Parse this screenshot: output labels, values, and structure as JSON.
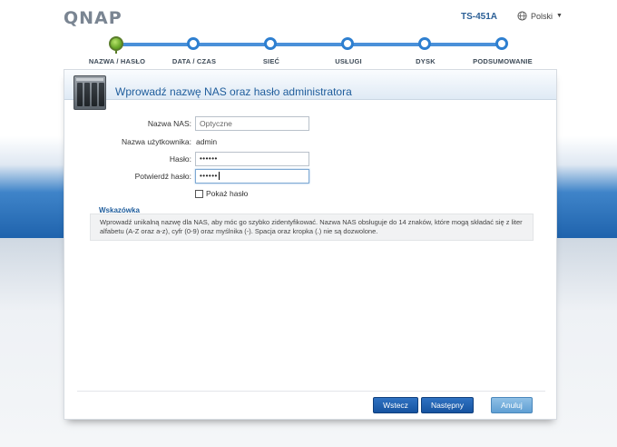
{
  "header": {
    "logo": "QNAP",
    "model": "TS-451A",
    "language": "Polski"
  },
  "steps": [
    {
      "label": "NAZWA / HASŁO",
      "active": true
    },
    {
      "label": "DATA / CZAS",
      "active": false
    },
    {
      "label": "SIEĆ",
      "active": false
    },
    {
      "label": "USŁUGI",
      "active": false
    },
    {
      "label": "DYSK",
      "active": false
    },
    {
      "label": "PODSUMOWANIE",
      "active": false
    }
  ],
  "panel": {
    "title": "Wprowadź nazwę NAS oraz hasło administratora",
    "nas_name_label": "Nazwa NAS:",
    "nas_name_value": "Optyczne",
    "username_label": "Nazwa użytkownika:",
    "username_value": "admin",
    "password_label": "Hasło:",
    "password_value": "••••••",
    "confirm_label": "Potwierdź hasło:",
    "confirm_value": "••••••",
    "show_password_label": "Pokaż hasło",
    "show_password_checked": false
  },
  "hint": {
    "title": "Wskazówka",
    "text": "Wprowadź unikalną nazwę dla NAS, aby móc go szybko zidentyfikować. Nazwa NAS obsługuje do 14 znaków, które mogą składać się z liter alfabetu (A-Z oraz a-z), cyfr (0-9) oraz myślnika (-). Spacja oraz kropka (.) nie są dozwolone."
  },
  "buttons": {
    "back": "Wstecz",
    "next": "Następny",
    "cancel": "Anuluj"
  },
  "colors": {
    "accent": "#1f5d9c",
    "step_line": "#4a90d9",
    "active_step": "#6aa829"
  }
}
